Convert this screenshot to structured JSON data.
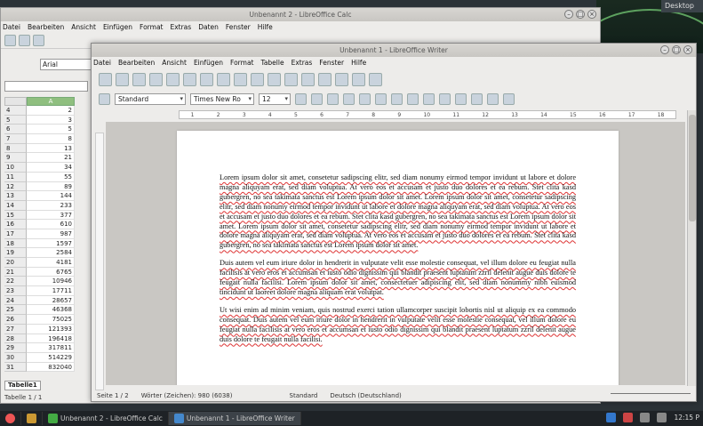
{
  "desktop": {
    "label": "Desktop"
  },
  "calc": {
    "title": "Unbenannt 2 - LibreOffice Calc",
    "menu": [
      "Datei",
      "Bearbeiten",
      "Ansicht",
      "Einfügen",
      "Format",
      "Extras",
      "Daten",
      "Fenster",
      "Hilfe"
    ],
    "font": "Arial",
    "column": "A",
    "rows": [
      {
        "n": "4",
        "v": "2"
      },
      {
        "n": "5",
        "v": "3"
      },
      {
        "n": "6",
        "v": "5"
      },
      {
        "n": "7",
        "v": "8"
      },
      {
        "n": "8",
        "v": "13"
      },
      {
        "n": "9",
        "v": "21"
      },
      {
        "n": "10",
        "v": "34"
      },
      {
        "n": "11",
        "v": "55"
      },
      {
        "n": "12",
        "v": "89"
      },
      {
        "n": "13",
        "v": "144"
      },
      {
        "n": "14",
        "v": "233"
      },
      {
        "n": "15",
        "v": "377"
      },
      {
        "n": "16",
        "v": "610"
      },
      {
        "n": "17",
        "v": "987"
      },
      {
        "n": "18",
        "v": "1597"
      },
      {
        "n": "19",
        "v": "2584"
      },
      {
        "n": "20",
        "v": "4181"
      },
      {
        "n": "21",
        "v": "6765"
      },
      {
        "n": "22",
        "v": "10946"
      },
      {
        "n": "23",
        "v": "17711"
      },
      {
        "n": "24",
        "v": "28657"
      },
      {
        "n": "25",
        "v": "46368"
      },
      {
        "n": "26",
        "v": "75025"
      },
      {
        "n": "27",
        "v": "121393"
      },
      {
        "n": "28",
        "v": "196418"
      },
      {
        "n": "29",
        "v": "317811"
      },
      {
        "n": "30",
        "v": "514229"
      },
      {
        "n": "31",
        "v": "832040"
      }
    ],
    "sheet_tab": "Tabelle1",
    "status": "Tabelle 1 / 1"
  },
  "writer": {
    "title": "Unbenannt 1 - LibreOffice Writer",
    "menu": [
      "Datei",
      "Bearbeiten",
      "Ansicht",
      "Einfügen",
      "Format",
      "Tabelle",
      "Extras",
      "Fenster",
      "Hilfe"
    ],
    "style": "Standard",
    "font": "Times New Ro",
    "size": "12",
    "ruler": [
      "1",
      "2",
      "3",
      "4",
      "5",
      "6",
      "7",
      "8",
      "9",
      "10",
      "11",
      "12",
      "13",
      "14",
      "15",
      "16",
      "17",
      "18"
    ],
    "paragraphs": [
      "Lorem ipsum dolor sit amet, consetetur sadipscing elitr, sed diam nonumy eirmod tempor invidunt ut labore et dolore magna aliquyam erat, sed diam voluptua. At vero eos et accusam et justo duo dolores et ea rebum. Stet clita kasd gubergren, no sea takimata sanctus est Lorem ipsum dolor sit amet. Lorem ipsum dolor sit amet, consetetur sadipscing elitr, sed diam nonumy eirmod tempor invidunt ut labore et dolore magna aliquyam erat, sed diam voluptua. At vero eos et accusam et justo duo dolores et ea rebum. Stet clita kasd gubergren, no sea takimata sanctus est Lorem ipsum dolor sit amet. Lorem ipsum dolor sit amet, consetetur sadipscing elitr, sed diam nonumy eirmod tempor invidunt ut labore et dolore magna aliquyam erat, sed diam voluptua. At vero eos et accusam et justo duo dolores et ea rebum. Stet clita kasd gubergren, no sea takimata sanctus est Lorem ipsum dolor sit amet.",
      "Duis autem vel eum iriure dolor in hendrerit in vulputate velit esse molestie consequat, vel illum dolore eu feugiat nulla facilisis at vero eros et accumsan et iusto odio dignissim qui blandit praesent luptatum zzril delenit augue duis dolore te feugait nulla facilisi. Lorem ipsum dolor sit amet, consectetuer adipiscing elit, sed diam nonummy nibh euismod tincidunt ut laoreet dolore magna aliquam erat volutpat.",
      "Ut wisi enim ad minim veniam, quis nostrud exerci tation ullamcorper suscipit lobortis nisl ut aliquip ex ea commodo consequat. Duis autem vel eum iriure dolor in hendrerit in vulputate velit esse molestie consequat, vel illum dolore eu feugiat nulla facilisis at vero eros et accumsan et iusto odio dignissim qui blandit praesent luptatum zzril delenit augue duis dolore te feugait nulla facilisi."
    ],
    "status_page": "Seite 1 / 2",
    "status_words": "Wörter (Zeichen): 980 (6038)",
    "status_style": "Standard",
    "status_lang": "Deutsch (Deutschland)"
  },
  "taskbar": {
    "items": [
      "Unbenannt 2 - LibreOffice Calc",
      "Unbenannt 1 - LibreOffice Writer"
    ],
    "clock": "12:15 P"
  },
  "colors": {
    "calc_accent": "#8fbf7f",
    "writer_bg": "#edecea"
  }
}
